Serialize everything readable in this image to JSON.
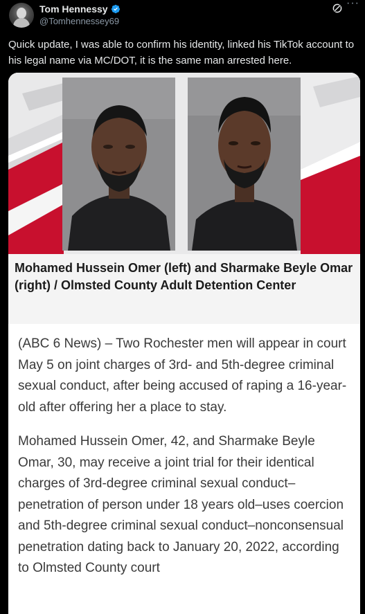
{
  "author": {
    "name": "Tom Hennessy",
    "handle": "@Tomhennessey69",
    "verified_color": "#1d9bf0"
  },
  "icons": {
    "grok": "grok-icon",
    "more": "more-icon"
  },
  "tweet": {
    "text": "Quick update, I was able to confirm his identity, linked his TikTok account to his legal name via MC/DOT,  it is the same man arrested here."
  },
  "media": {
    "caption": "Mohamed Hussein Omer (left) and Sharmake Beyle Omar (right) / Olmsted County Adult Detention Center",
    "paragraph1": "(ABC 6 News) – Two Rochester men will appear in court May 5 on joint charges of 3rd- and 5th-degree criminal sexual conduct, after being accused of raping a 16-year-old after offering her a place to stay.",
    "paragraph2": "Mohamed Hussein Omer, 42, and Sharmake Beyle Omar, 30, may receive a joint trial for their identical charges of 3rd-degree criminal sexual conduct–penetration of person under 18 years old–uses coercion and 5th-degree criminal sexual conduct–nonconsensual penetration dating back to January 20, 2022, according to Olmsted County court"
  }
}
